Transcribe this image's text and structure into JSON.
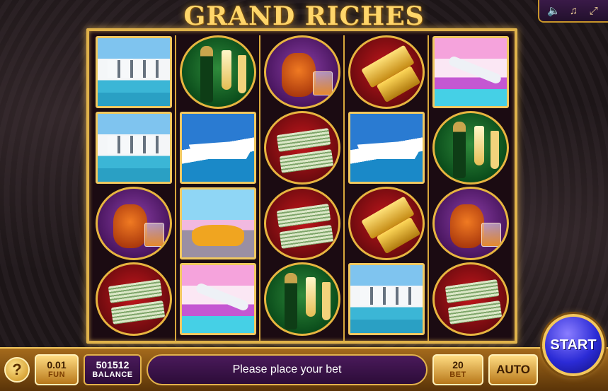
{
  "title": "GRAND RICHES",
  "sound_controls": [
    {
      "icon": "speaker-icon",
      "glyph": "🔈"
    },
    {
      "icon": "music-note-icon",
      "glyph": "♫"
    },
    {
      "icon": "fullscreen-icon",
      "glyph": "⤢"
    }
  ],
  "reels": [
    [
      "villa",
      "villa",
      "cognac",
      "money"
    ],
    [
      "champagne",
      "yacht",
      "car",
      "jet"
    ],
    [
      "cognac",
      "money",
      "money",
      "champagne"
    ],
    [
      "gold",
      "yacht",
      "gold",
      "villa"
    ],
    [
      "jet",
      "champagne",
      "cognac",
      "money"
    ]
  ],
  "bottom_bar": {
    "help_label": "?",
    "coin_value": "0.01",
    "coin_label": "FUN",
    "balance_value": "501512",
    "balance_label": "BALANCE",
    "message": "Please place your bet",
    "bet_value": "20",
    "bet_label": "BET",
    "auto_label": "AUTO",
    "start_label": "START"
  },
  "colors": {
    "frame_gold": "#e0b24a",
    "panel_purple": "#4a1a5b",
    "start_blue": "#2b2bd6"
  }
}
